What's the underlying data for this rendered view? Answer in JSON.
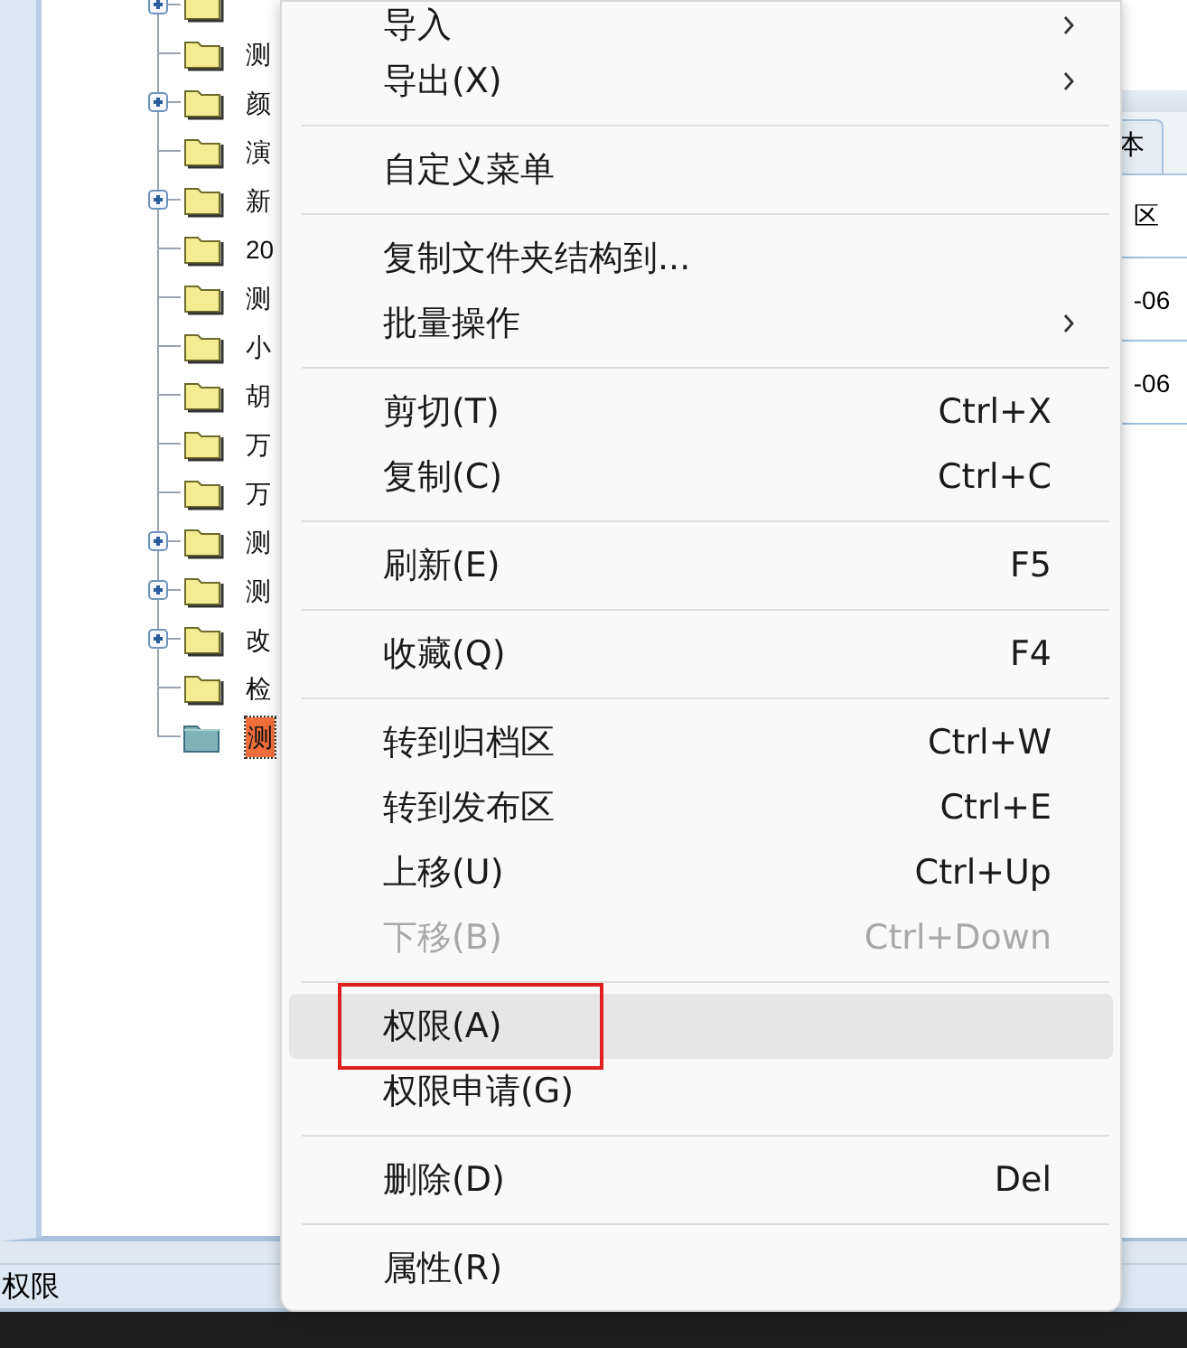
{
  "tree": {
    "items": [
      {
        "expandable": true,
        "selected": false
      },
      {
        "label": "测",
        "expandable": false,
        "selected": false
      },
      {
        "label": "颜",
        "expandable": true,
        "selected": false
      },
      {
        "label": "演",
        "expandable": false,
        "selected": false
      },
      {
        "label": "新",
        "expandable": true,
        "selected": false
      },
      {
        "label": "20",
        "expandable": false,
        "selected": false
      },
      {
        "label": "测",
        "expandable": false,
        "selected": false
      },
      {
        "label": "小",
        "expandable": false,
        "selected": false
      },
      {
        "label": "胡",
        "expandable": false,
        "selected": false
      },
      {
        "label": "万",
        "expandable": false,
        "selected": false
      },
      {
        "label": "万",
        "expandable": false,
        "selected": false
      },
      {
        "label": "测",
        "expandable": true,
        "selected": false
      },
      {
        "label": "测",
        "expandable": true,
        "selected": false
      },
      {
        "label": "改",
        "expandable": true,
        "selected": false
      },
      {
        "label": "检",
        "expandable": false,
        "selected": false
      },
      {
        "label": "测",
        "expandable": false,
        "selected": true
      }
    ]
  },
  "right_panel": {
    "tab": "本",
    "cells": [
      "区",
      "-06",
      "-06"
    ]
  },
  "status_bar": "权限",
  "context_menu": {
    "items": [
      {
        "kind": "item",
        "label": "导入",
        "submenu": true,
        "disabled": false,
        "selected": false,
        "outlined": false
      },
      {
        "kind": "item",
        "label": "导出(X)",
        "submenu": true,
        "disabled": false,
        "selected": false,
        "outlined": false
      },
      {
        "kind": "separator"
      },
      {
        "kind": "item",
        "label": "自定义菜单",
        "submenu": false,
        "disabled": false,
        "selected": false,
        "outlined": false
      },
      {
        "kind": "separator"
      },
      {
        "kind": "item",
        "label": "复制文件夹结构到...",
        "submenu": false,
        "disabled": false,
        "selected": false,
        "outlined": false
      },
      {
        "kind": "item",
        "label": "批量操作",
        "submenu": true,
        "disabled": false,
        "selected": false,
        "outlined": false
      },
      {
        "kind": "separator"
      },
      {
        "kind": "item",
        "label": "剪切(T)",
        "shortcut": "Ctrl+X",
        "submenu": false,
        "disabled": false,
        "selected": false,
        "outlined": false
      },
      {
        "kind": "item",
        "label": "复制(C)",
        "shortcut": "Ctrl+C",
        "submenu": false,
        "disabled": false,
        "selected": false,
        "outlined": false
      },
      {
        "kind": "separator"
      },
      {
        "kind": "item",
        "label": "刷新(E)",
        "shortcut": "F5",
        "submenu": false,
        "disabled": false,
        "selected": false,
        "outlined": false
      },
      {
        "kind": "separator"
      },
      {
        "kind": "item",
        "label": "收藏(Q)",
        "shortcut": "F4",
        "submenu": false,
        "disabled": false,
        "selected": false,
        "outlined": false
      },
      {
        "kind": "separator"
      },
      {
        "kind": "item",
        "label": "转到归档区",
        "shortcut": "Ctrl+W",
        "submenu": false,
        "disabled": false,
        "selected": false,
        "outlined": false
      },
      {
        "kind": "item",
        "label": "转到发布区",
        "shortcut": "Ctrl+E",
        "submenu": false,
        "disabled": false,
        "selected": false,
        "outlined": false
      },
      {
        "kind": "item",
        "label": "上移(U)",
        "shortcut": "Ctrl+Up",
        "submenu": false,
        "disabled": false,
        "selected": false,
        "outlined": false
      },
      {
        "kind": "item",
        "label": "下移(B)",
        "shortcut": "Ctrl+Down",
        "submenu": false,
        "disabled": true,
        "selected": false,
        "outlined": false
      },
      {
        "kind": "separator"
      },
      {
        "kind": "item",
        "label": "权限(A)",
        "submenu": false,
        "disabled": false,
        "selected": true,
        "outlined": true
      },
      {
        "kind": "item",
        "label": "权限申请(G)",
        "submenu": false,
        "disabled": false,
        "selected": false,
        "outlined": false
      },
      {
        "kind": "separator"
      },
      {
        "kind": "item",
        "label": "删除(D)",
        "shortcut": "Del",
        "submenu": false,
        "disabled": false,
        "selected": false,
        "outlined": false
      },
      {
        "kind": "separator"
      },
      {
        "kind": "item",
        "label": "属性(R)",
        "submenu": false,
        "disabled": false,
        "selected": false,
        "outlined": false
      }
    ]
  }
}
